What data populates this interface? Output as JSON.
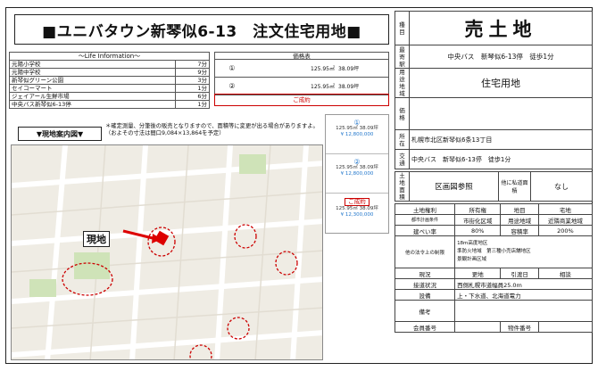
{
  "title": "■ユニバタウン新琴似6-13　注文住宅用地■",
  "life_info": {
    "header": "～Life Information～",
    "rows": [
      {
        "name": "元陽小学校",
        "dist": "7分"
      },
      {
        "name": "元陽中学校",
        "dist": "9分"
      },
      {
        "name": "新琴似グリーン公園",
        "dist": "3分"
      },
      {
        "name": "セイコーマート",
        "dist": "1分"
      },
      {
        "name": "ジェイアール生鮮市場",
        "dist": "6分"
      },
      {
        "name": "中央バス新琴似6-13停",
        "dist": "1分"
      }
    ]
  },
  "price_table": {
    "header": "価格表",
    "rows": [
      {
        "no": "①",
        "area": "125.95㎡",
        "tsubo": "38.09坪"
      },
      {
        "no": "②",
        "area": "125.95㎡",
        "tsubo": "38.09坪"
      }
    ],
    "sold_label": "ご成約"
  },
  "map_label": "▼現地案内図▼",
  "note": "＊確定測量、分筆後の販売となりますので、面積等に変更が出る場合がありますよ。（およその寸法は間口9,084×13,864を予定）",
  "site_label": "現地",
  "lots": [
    {
      "num": "①",
      "line1": "125.95㎡ 38.09坪",
      "line2": "¥ 12,800,000"
    },
    {
      "num": "②",
      "line1": "125.95㎡ 38.09坪",
      "line2": "¥ 12,800,000"
    },
    {
      "num": "ご成約",
      "line1": "125.95㎡ 38.09坪",
      "line2": "¥ 12,300,000"
    }
  ],
  "right": {
    "type_label": "種目",
    "type_value": "売土地",
    "station_label": "最寄駅",
    "station_value": "中央バス　新琴似6-13停　徒歩1分",
    "use_label": "用途地域",
    "use_value": "住宅用地",
    "price_label": "価格",
    "address_label": "所在",
    "address_value": "札幌市北区新琴似6条13丁目",
    "traffic_label": "交通",
    "traffic_value": "中央バス　新琴似6-13停　徒歩1分",
    "land_label": "土地面積",
    "land_value": "区画図参照",
    "other_label": "他に私道面積",
    "other_value": "なし"
  },
  "bottom": {
    "row1": [
      "土地権利",
      "所有権",
      "地目",
      "宅地"
    ],
    "row2": [
      "都市計画条件",
      "市街化区域",
      "用途地域",
      "近隣商業地域"
    ],
    "row3": [
      "建ぺい率",
      "80%",
      "容積率",
      "200%"
    ],
    "row4_label": "他の法令上の制限",
    "row4_value": "18m高度地区\n準防火地域　第三種小売店舗地区\n景観計画区域",
    "row5": [
      "現況",
      "更地",
      "引渡日",
      "相談"
    ],
    "row6": [
      "接道状況",
      "西側札幌市道幅員25.0m"
    ],
    "row7": [
      "設備",
      "上・下水道、北海道電力"
    ],
    "row8": [
      "備考",
      ""
    ],
    "row9": [
      "会員番号",
      "",
      "物件番号",
      ""
    ]
  }
}
